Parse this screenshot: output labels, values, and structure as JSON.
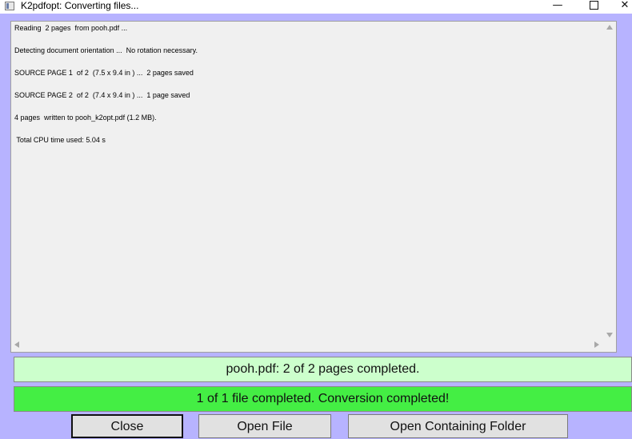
{
  "window": {
    "title": "K2pdfopt: Converting files...",
    "controls": {
      "minimize": "—",
      "close": "✕"
    }
  },
  "log": {
    "lines": [
      "Reading  2 pages  from pooh.pdf ...",
      "Detecting document orientation ...  No rotation necessary.",
      "SOURCE PAGE 1  of 2  (7.5 x 9.4 in ) ...  2 pages saved",
      "SOURCE PAGE 2  of 2  (7.4 x 9.4 in ) ...  1 page saved",
      "4 pages  written to pooh_k2opt.pdf (1.2 MB).",
      " Total CPU time used: 5.04 s"
    ]
  },
  "status": {
    "file_progress": "pooh.pdf: 2 of 2 pages completed.",
    "overall_progress": "1 of 1 file completed.  Conversion completed!"
  },
  "buttons": {
    "close": "Close",
    "open_file": "Open File",
    "open_folder": "Open Containing Folder"
  },
  "colors": {
    "background": "#b7b3ff",
    "file_status_bg": "#ccffcc",
    "overall_status_bg": "#44ee44"
  }
}
